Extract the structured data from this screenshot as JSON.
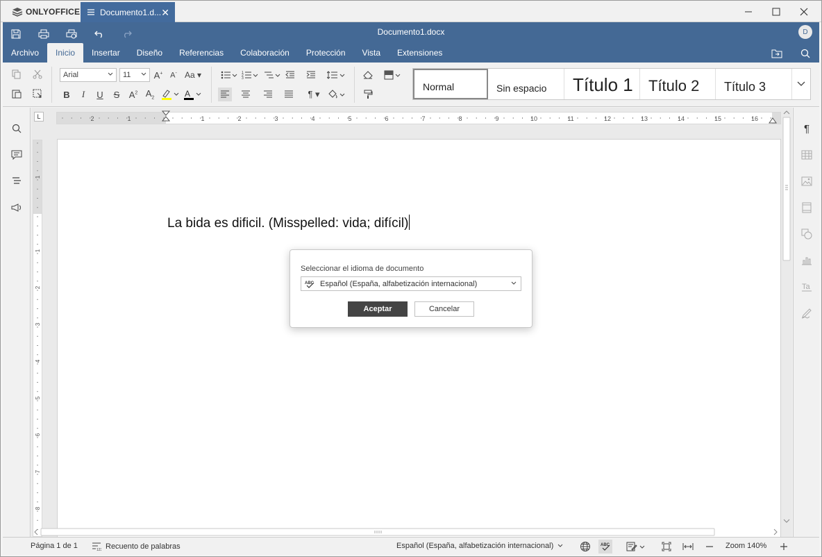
{
  "app": {
    "brand": "ONLYOFFICE",
    "tab_title": "Documento1.d...",
    "window_title": "Documento1.docx",
    "user_initial": "D"
  },
  "menu": {
    "tabs": [
      "Archivo",
      "Inicio",
      "Insertar",
      "Diseño",
      "Referencias",
      "Colaboración",
      "Protección",
      "Vista",
      "Extensiones"
    ],
    "active": "Inicio"
  },
  "toolbar": {
    "font_name": "Arial",
    "font_size": "11",
    "styles": [
      "Normal",
      "Sin espacio",
      "Título 1",
      "Título 2",
      "Título 3"
    ],
    "selected_style": "Normal",
    "highlight_color": "#ffff00",
    "font_color": "#000000"
  },
  "ruler": {
    "h_labels": [
      "2",
      "1",
      "1",
      "2",
      "3",
      "4",
      "5",
      "6",
      "7",
      "8",
      "9",
      "10",
      "11",
      "12",
      "13",
      "14",
      "15",
      "16"
    ],
    "v_labels": [
      "1",
      "1",
      "2",
      "3",
      "4",
      "5",
      "6",
      "7",
      "8"
    ],
    "corner_label": "L"
  },
  "document": {
    "text": "La bida es dificil. (Misspelled: vida; difícil)"
  },
  "dialog": {
    "label": "Seleccionar el idioma de documento",
    "selected_language": "Español (España, alfabetización internacional)",
    "ok_label": "Aceptar",
    "cancel_label": "Cancelar"
  },
  "status": {
    "page": "Página 1 de 1",
    "word_count": "Recuento de palabras",
    "language": "Español (España, alfabetización internacional)",
    "zoom": "Zoom 140%"
  },
  "colors": {
    "header_blue": "#446995",
    "tab_blue": "#436b9d",
    "ok_button": "#444444"
  }
}
